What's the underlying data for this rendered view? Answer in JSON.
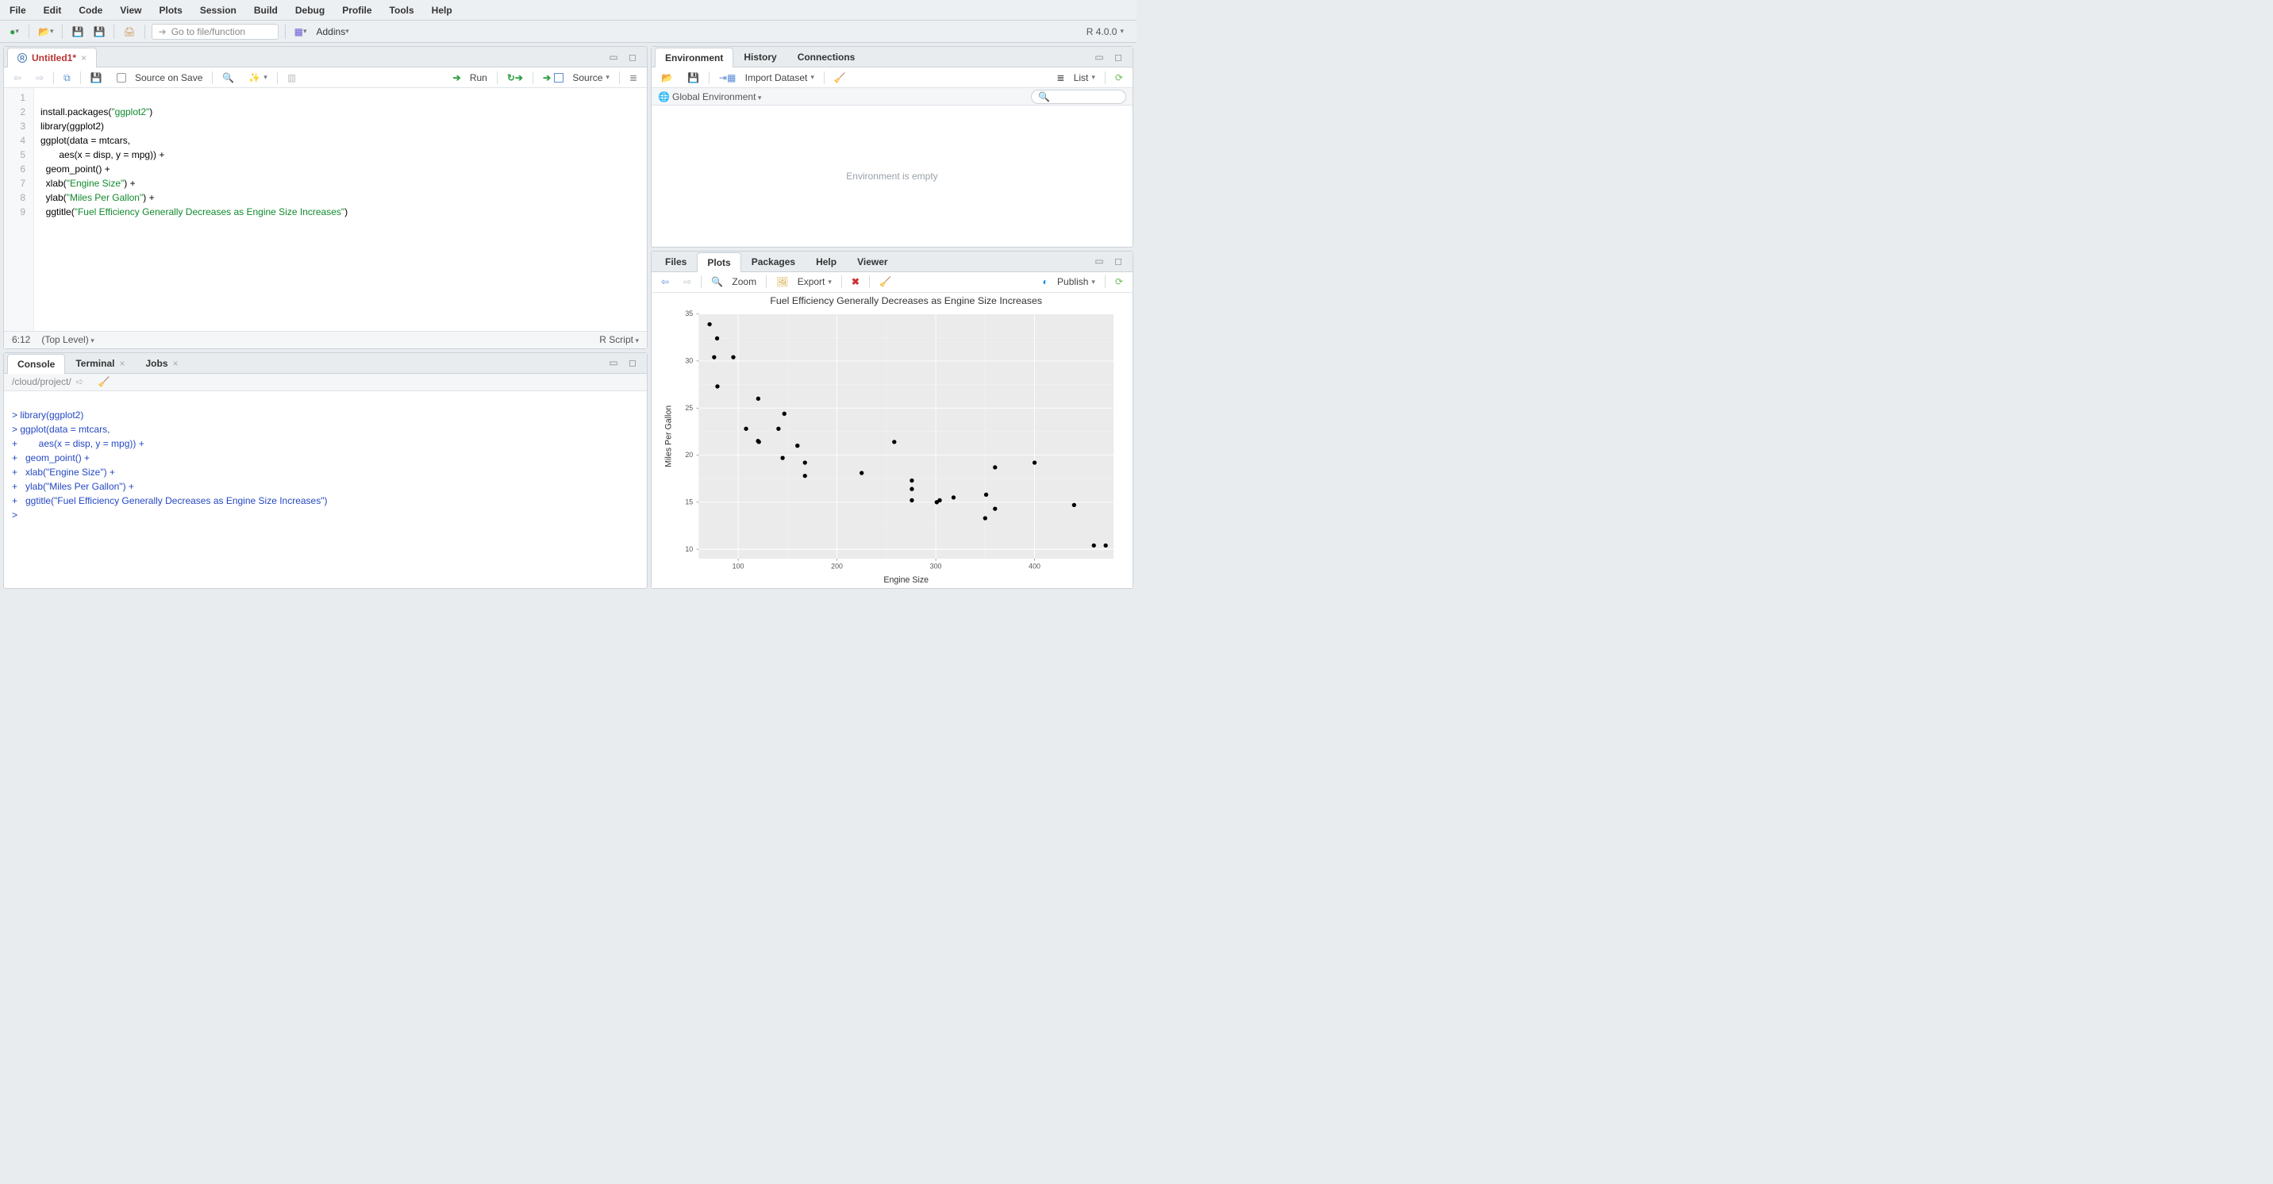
{
  "menubar": [
    "File",
    "Edit",
    "Code",
    "View",
    "Plots",
    "Session",
    "Build",
    "Debug",
    "Profile",
    "Tools",
    "Help"
  ],
  "maintoolbar": {
    "goto_placeholder": "Go to file/function",
    "addins_label": "Addins",
    "r_version": "R 4.0.0"
  },
  "source": {
    "tab_title": "Untitled1*",
    "source_on_save": "Source on Save",
    "run_label": "Run",
    "source_label": "Source",
    "status_pos": "6:12",
    "status_scope": "(Top Level)",
    "status_type": "R Script",
    "lines": [
      1,
      2,
      3,
      4,
      5,
      6,
      7,
      8,
      9
    ],
    "code": {
      "l1a": "install.packages(",
      "l1b": "\"ggplot2\"",
      "l1c": ")",
      "l2a": "library(",
      "l2b": "ggplot2",
      "l2c": ")",
      "l3": "ggplot(data = mtcars,",
      "l4": "       aes(x = disp, y = mpg)) +",
      "l5": "  geom_point() +",
      "l6a": "  xlab(",
      "l6b": "\"Engine Size\"",
      "l6c": ") +",
      "l7a": "  ylab(",
      "l7b": "\"Miles Per Gallon\"",
      "l7c": ") +",
      "l8a": "  ggtitle(",
      "l8b": "\"Fuel Efficiency Generally Decreases as Engine Size Increases\"",
      "l8c": ")"
    }
  },
  "console": {
    "tabs": [
      "Console",
      "Terminal",
      "Jobs"
    ],
    "path": "/cloud/project/",
    "lines": [
      "> library(ggplot2)",
      "> ggplot(data = mtcars,",
      "+        aes(x = disp, y = mpg)) +",
      "+   geom_point() +",
      "+   xlab(\"Engine Size\") +",
      "+   ylab(\"Miles Per Gallon\") +",
      "+   ggtitle(\"Fuel Efficiency Generally Decreases as Engine Size Increases\")",
      "> "
    ]
  },
  "env": {
    "tabs": [
      "Environment",
      "History",
      "Connections"
    ],
    "import_label": "Import Dataset",
    "list_label": "List",
    "scope_label": "Global Environment",
    "empty_msg": "Environment is empty",
    "search_placeholder": ""
  },
  "plots": {
    "tabs": [
      "Files",
      "Plots",
      "Packages",
      "Help",
      "Viewer"
    ],
    "zoom_label": "Zoom",
    "export_label": "Export",
    "publish_label": "Publish"
  },
  "chart_data": {
    "type": "scatter",
    "title": "Fuel Efficiency Generally Decreases as Engine Size Increases",
    "xlabel": "Engine Size",
    "ylabel": "Miles Per Gallon",
    "xlim": [
      60,
      480
    ],
    "ylim": [
      9,
      35
    ],
    "xticks": [
      100,
      200,
      300,
      400
    ],
    "yticks": [
      10,
      15,
      20,
      25,
      30,
      35
    ],
    "points": [
      {
        "x": 160,
        "y": 21.0
      },
      {
        "x": 160,
        "y": 21.0
      },
      {
        "x": 108,
        "y": 22.8
      },
      {
        "x": 258,
        "y": 21.4
      },
      {
        "x": 360,
        "y": 18.7
      },
      {
        "x": 225,
        "y": 18.1
      },
      {
        "x": 360,
        "y": 14.3
      },
      {
        "x": 146.7,
        "y": 24.4
      },
      {
        "x": 140.8,
        "y": 22.8
      },
      {
        "x": 167.6,
        "y": 19.2
      },
      {
        "x": 167.6,
        "y": 17.8
      },
      {
        "x": 275.8,
        "y": 16.4
      },
      {
        "x": 275.8,
        "y": 17.3
      },
      {
        "x": 275.8,
        "y": 15.2
      },
      {
        "x": 472,
        "y": 10.4
      },
      {
        "x": 460,
        "y": 10.4
      },
      {
        "x": 440,
        "y": 14.7
      },
      {
        "x": 78.7,
        "y": 32.4
      },
      {
        "x": 75.7,
        "y": 30.4
      },
      {
        "x": 71.1,
        "y": 33.9
      },
      {
        "x": 120.1,
        "y": 21.5
      },
      {
        "x": 318,
        "y": 15.5
      },
      {
        "x": 304,
        "y": 15.2
      },
      {
        "x": 350,
        "y": 13.3
      },
      {
        "x": 400,
        "y": 19.2
      },
      {
        "x": 79,
        "y": 27.3
      },
      {
        "x": 120.3,
        "y": 26.0
      },
      {
        "x": 95.1,
        "y": 30.4
      },
      {
        "x": 351,
        "y": 15.8
      },
      {
        "x": 145,
        "y": 19.7
      },
      {
        "x": 301,
        "y": 15.0
      },
      {
        "x": 121,
        "y": 21.4
      }
    ]
  }
}
